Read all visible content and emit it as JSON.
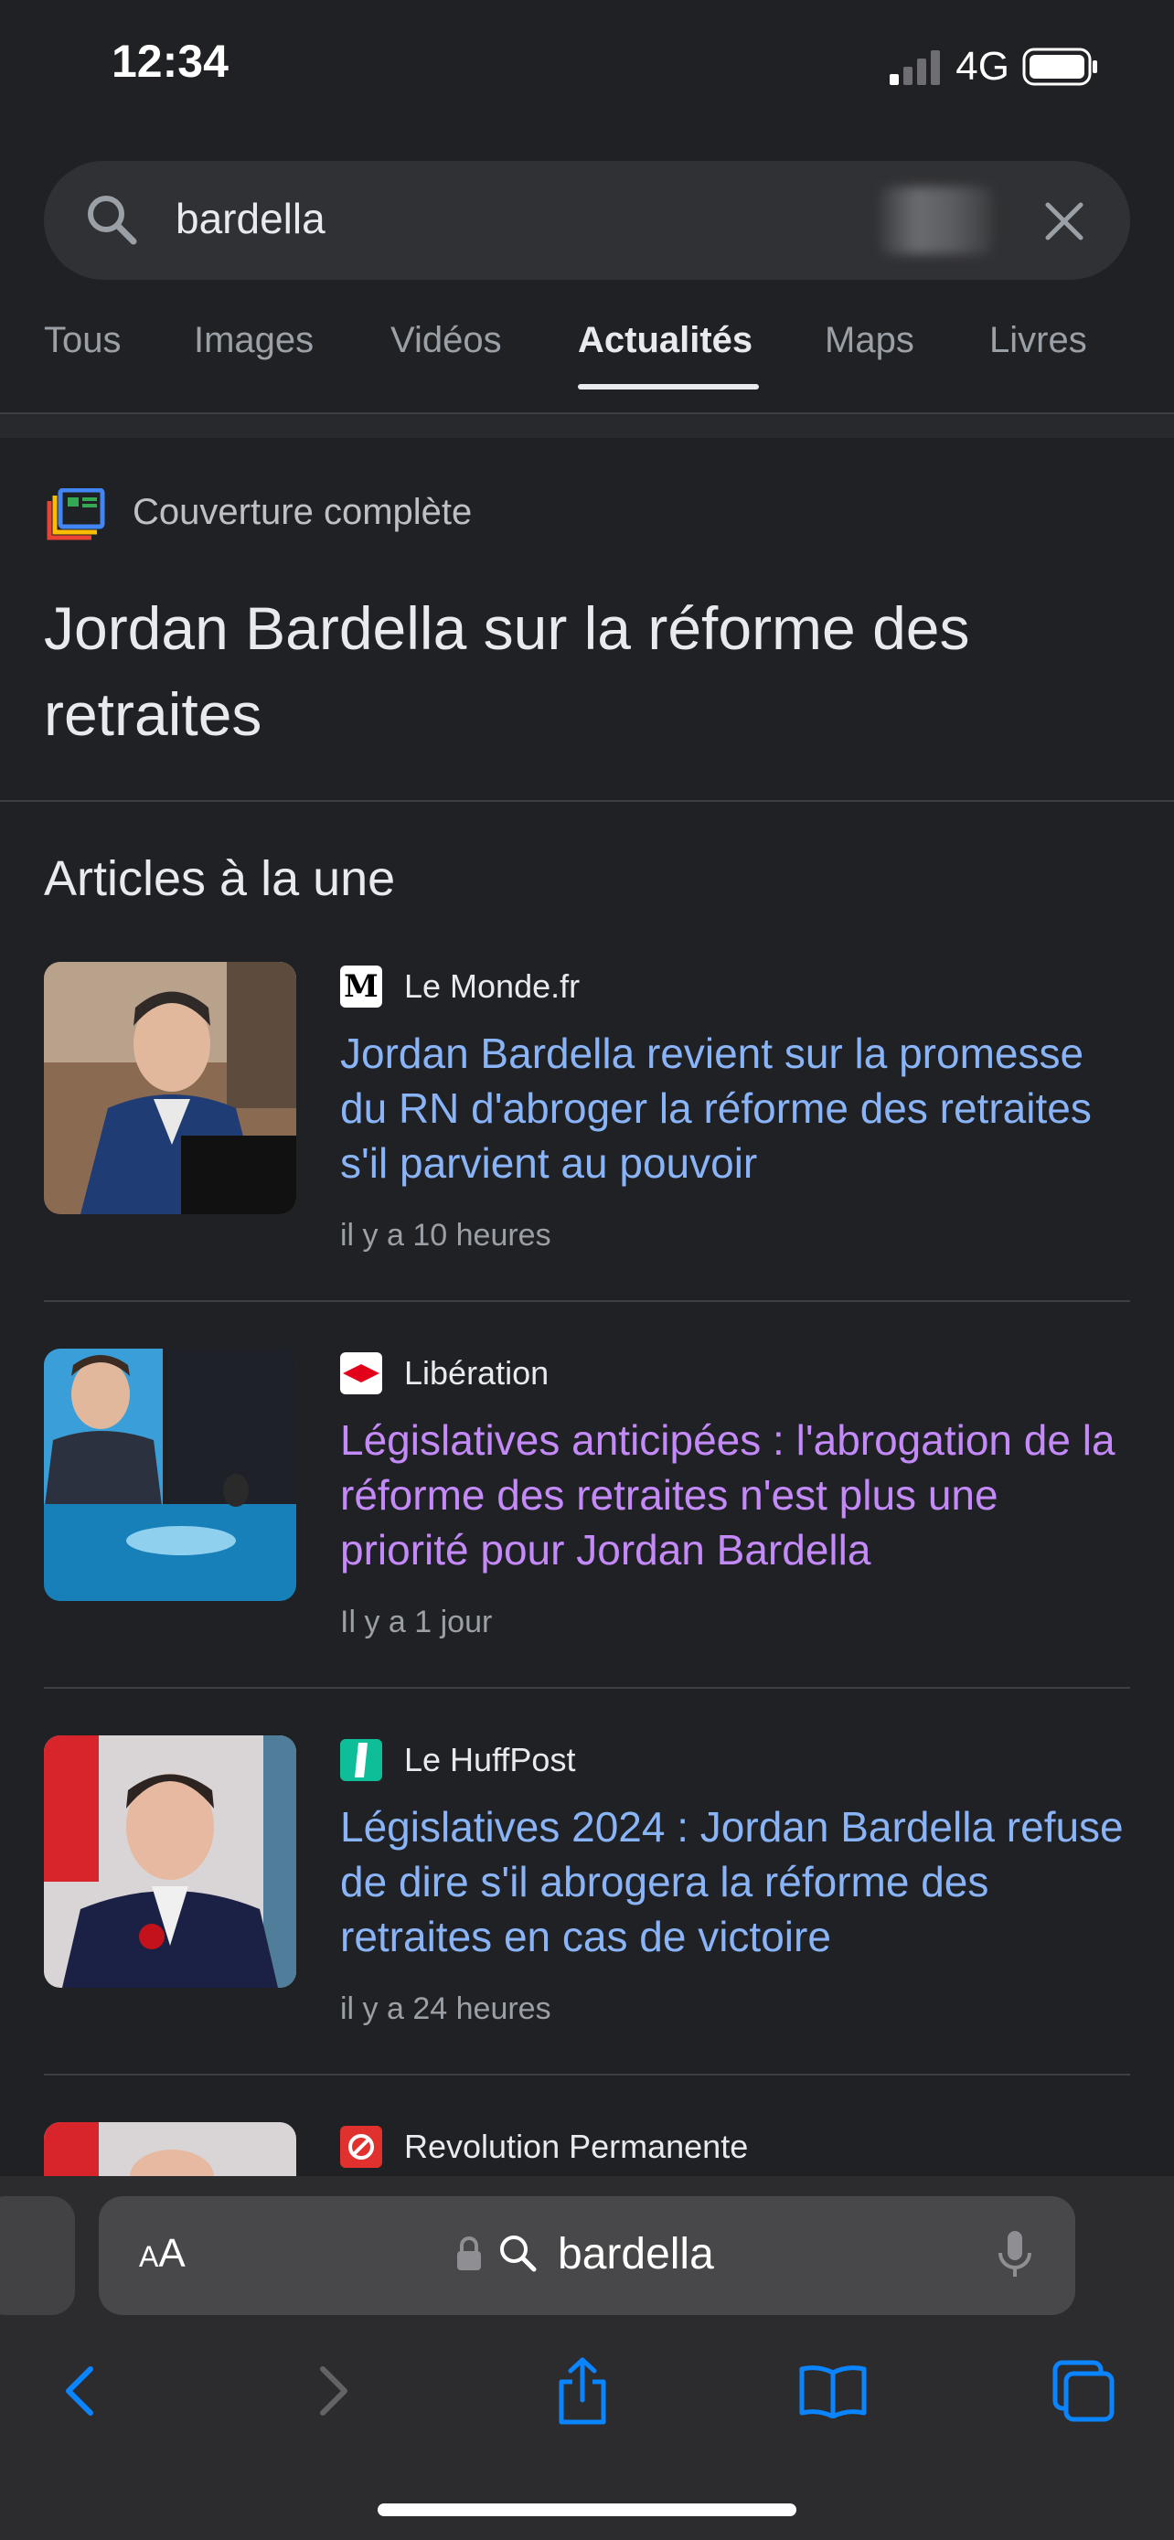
{
  "status_bar": {
    "time": "12:34",
    "network": "4G",
    "battery_level": 0.95
  },
  "search": {
    "query": "bardella"
  },
  "tabs": [
    {
      "label": "Tous"
    },
    {
      "label": "Images"
    },
    {
      "label": "Vidéos"
    },
    {
      "label": "Actualités",
      "active": true
    },
    {
      "label": "Maps"
    },
    {
      "label": "Livres"
    }
  ],
  "coverage": {
    "label": "Couverture complète",
    "title": "Jordan Bardella sur la réforme des retraites"
  },
  "top_articles_heading": "Articles à la une",
  "articles": [
    {
      "source": "Le Monde.fr",
      "headline": "Jordan Bardella revient sur la promesse du RN d'abroger la réforme des retraites s'il parvient au pouvoir",
      "time": "il y a 10 heures",
      "visited": false
    },
    {
      "source": "Libération",
      "headline": "Législatives anticipées : l'abrogation de la réforme des retraites n'est plus une priorité pour Jordan Bardella",
      "time": "Il y a 1 jour",
      "visited": true
    },
    {
      "source": "Le HuffPost",
      "headline": "Législatives 2024 : Jordan Bardella refuse de dire s'il abrogera la réforme des retraites en cas de victoire",
      "time": "il y a 24 heures",
      "visited": false
    },
    {
      "source": "Revolution Permanente",
      "headline": "",
      "time": "",
      "visited": false
    }
  ],
  "browser": {
    "text_size_label": "AA",
    "address": "bardella"
  },
  "colors": {
    "link": "#8ab4f8",
    "visited_link": "#c58af9",
    "safari_blue": "#0a84ff"
  }
}
